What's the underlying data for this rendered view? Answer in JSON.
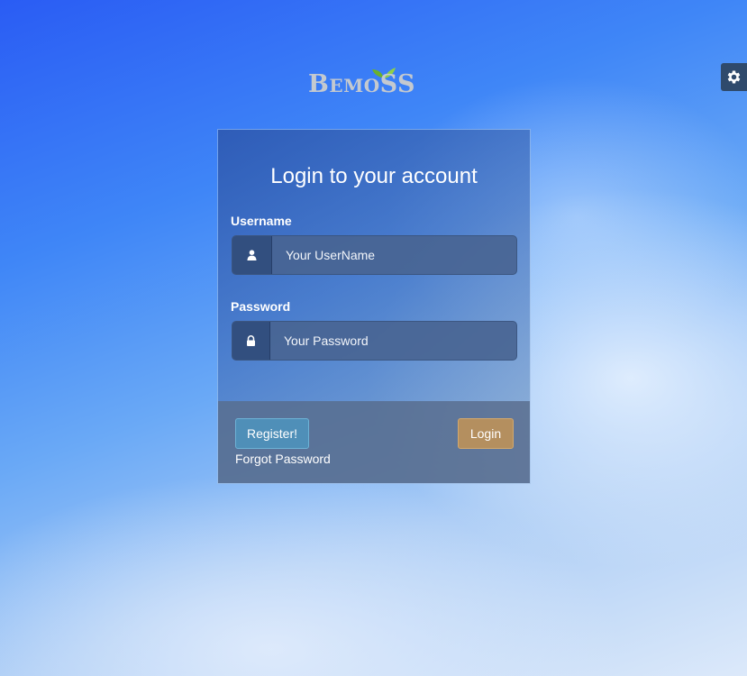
{
  "logo": {
    "text_b": "B",
    "text_emo": "EMO",
    "text_s1": "S",
    "text_s2": "S"
  },
  "settings": {
    "icon": "gear-icon"
  },
  "login": {
    "title": "Login to your account",
    "username": {
      "label": "Username",
      "value": "",
      "placeholder": "Your UserName",
      "icon": "user-icon"
    },
    "password": {
      "label": "Password",
      "value": "",
      "placeholder": "Your Password",
      "icon": "lock-icon"
    },
    "register_label": "Register!",
    "login_label": "Login",
    "forgot_label": "Forgot Password"
  },
  "colors": {
    "register_button": "#4f8fb8",
    "login_button": "#b48f5f",
    "settings_tab": "#2f4a6c",
    "logo_leaf": "#6bb02c",
    "logo_text": "#c4c9cf"
  }
}
